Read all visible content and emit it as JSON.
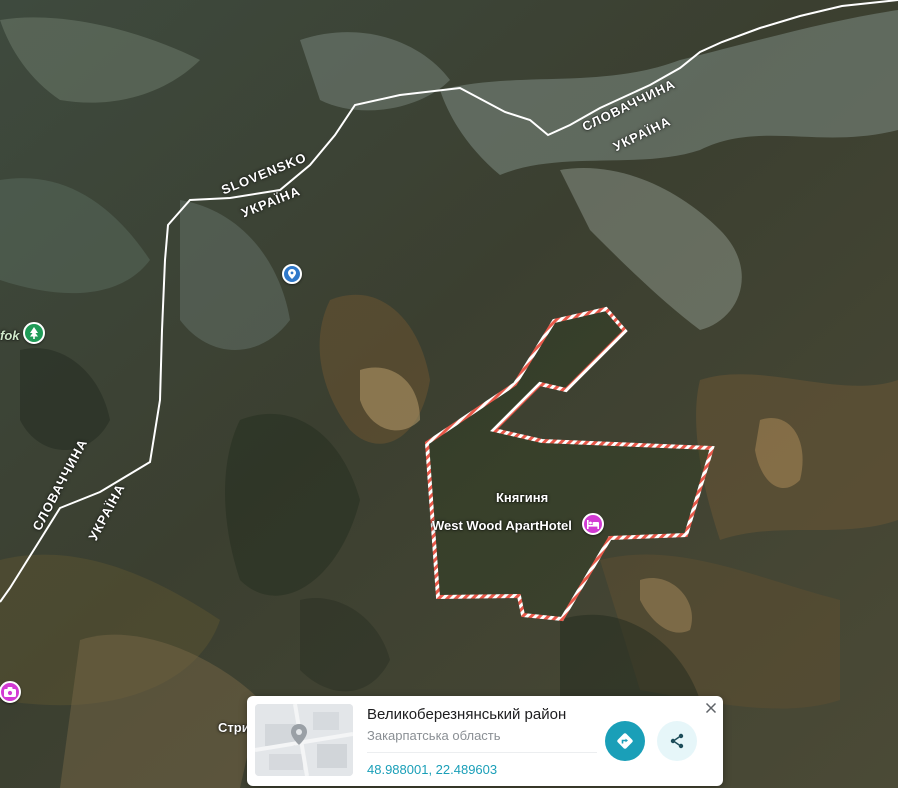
{
  "map": {
    "border_labels": {
      "top_left_country_a": "SLOVENSKO",
      "top_left_country_b": "УКРАЇНА",
      "top_right_country_a": "СЛОВАЧЧИНА",
      "top_right_country_b": "УКРАЇНА",
      "left_country_a": "СЛОВАЧЧИНА",
      "left_country_b": "УКРАЇНА"
    },
    "places": {
      "area_name": "Княгиня",
      "hotel_name": "West Wood ApartHotel",
      "park_partial": "fok",
      "town_partial": "Стри"
    },
    "icons": {
      "hotel": "hotel-icon",
      "park": "tree-icon",
      "location": "location-pin-icon",
      "camera": "camera-icon"
    },
    "colors": {
      "hotel_pin": "#d23ad3",
      "park_pin": "#1f9b57",
      "location_pin": "#2f78c9",
      "boundary": "#e8594a",
      "border_line": "#ffffff",
      "accent": "#1a9fb8"
    }
  },
  "info_card": {
    "title": "Великоберезнянський район",
    "subtitle": "Закарпатська область",
    "coordinates": "48.988001, 22.489603",
    "thumbnail_icon": "map-thumbnail-icon",
    "directions_icon": "directions-icon",
    "share_icon": "share-icon",
    "close_icon": "close-icon"
  }
}
